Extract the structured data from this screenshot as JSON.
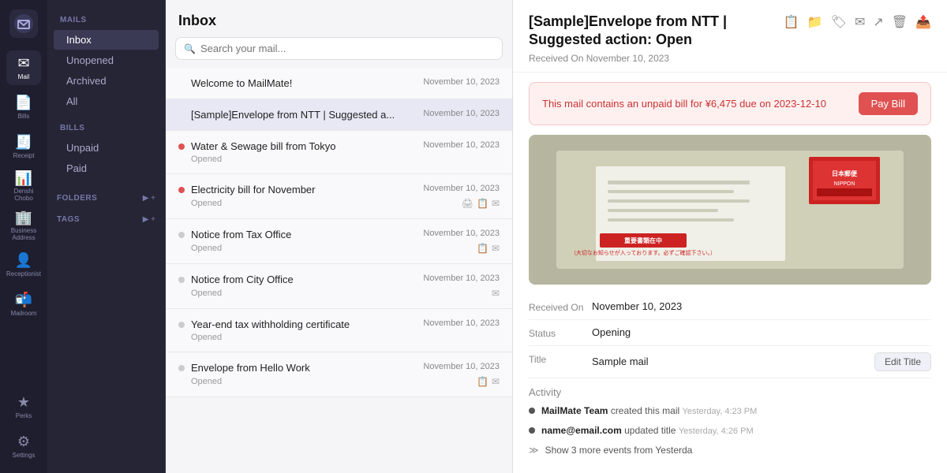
{
  "app": {
    "logo_icon": "●"
  },
  "sidebar": {
    "items": [
      {
        "id": "mail",
        "label": "Mail",
        "icon": "✉",
        "active": true
      },
      {
        "id": "bills",
        "label": "Bills",
        "icon": "📄",
        "active": false
      },
      {
        "id": "receipt",
        "label": "Receipt",
        "icon": "🧾",
        "active": false
      },
      {
        "id": "denshi",
        "label": "Denshi\nChobo",
        "icon": "📊",
        "active": false
      },
      {
        "id": "business",
        "label": "Business\nAddress",
        "icon": "🏢",
        "active": false
      },
      {
        "id": "receptionist",
        "label": "Receptionist",
        "icon": "👤",
        "active": false
      },
      {
        "id": "mailroom",
        "label": "Mailroom",
        "icon": "📬",
        "active": false
      }
    ],
    "bottom_items": [
      {
        "id": "perks",
        "label": "Perks",
        "icon": "★"
      },
      {
        "id": "settings",
        "label": "Settings",
        "icon": "⚙"
      }
    ]
  },
  "nav": {
    "mails_label": "MAILS",
    "mails_items": [
      {
        "id": "inbox",
        "label": "Inbox",
        "active": true
      },
      {
        "id": "unopened",
        "label": "Unopened",
        "active": false
      },
      {
        "id": "archived",
        "label": "Archived",
        "active": false
      },
      {
        "id": "all",
        "label": "All",
        "active": false
      }
    ],
    "bills_label": "BILLS",
    "bills_items": [
      {
        "id": "unpaid",
        "label": "Unpaid",
        "active": false
      },
      {
        "id": "paid",
        "label": "Paid",
        "active": false
      }
    ],
    "folders_label": "FOLDERS",
    "tags_label": "TAGS"
  },
  "mail_list": {
    "title": "Inbox",
    "search_placeholder": "Search your mail...",
    "items": [
      {
        "id": "welcome",
        "subject": "Welcome to MailMate!",
        "date": "November 10, 2023",
        "status": "",
        "dot": "none",
        "selected": false,
        "icons": []
      },
      {
        "id": "ntt",
        "subject": "[Sample]Envelope from NTT | Suggested a...",
        "date": "November 10, 2023",
        "status": "",
        "dot": "none",
        "selected": true,
        "icons": []
      },
      {
        "id": "water",
        "subject": "Water & Sewage bill from Tokyo",
        "date": "November 10, 2023",
        "status": "Opened",
        "dot": "red",
        "selected": false,
        "icons": []
      },
      {
        "id": "electricity",
        "subject": "Electricity bill for November",
        "date": "November 10, 2023",
        "status": "Opened",
        "dot": "red",
        "selected": false,
        "icons": [
          "🖨",
          "📋",
          "✉"
        ]
      },
      {
        "id": "tax",
        "subject": "Notice from Tax Office",
        "date": "November 10, 2023",
        "status": "Opened",
        "dot": "gray",
        "selected": false,
        "icons": [
          "📋",
          "✉"
        ]
      },
      {
        "id": "city",
        "subject": "Notice from City Office",
        "date": "November 10, 2023",
        "status": "Opened",
        "dot": "gray",
        "selected": false,
        "icons": [
          "✉"
        ]
      },
      {
        "id": "yearend",
        "subject": "Year-end tax withholding certificate",
        "date": "November 10, 2023",
        "status": "Opened",
        "dot": "gray",
        "selected": false,
        "icons": []
      },
      {
        "id": "hellowork",
        "subject": "Envelope from Hello Work",
        "date": "November 10, 2023",
        "status": "Opened",
        "dot": "gray",
        "selected": false,
        "icons": [
          "📋",
          "✉"
        ]
      }
    ]
  },
  "detail": {
    "title": "[Sample]Envelope from NTT | Suggested action: Open",
    "received_label": "Received On November 10, 2023",
    "toolbar_icons": [
      "📋",
      "📁",
      "🏷",
      "✉",
      "↗",
      "🗑",
      "📤"
    ],
    "bill_banner": {
      "text_before": "This mail contains an unpaid bill for",
      "amount": "¥6,475",
      "text_middle": "due on",
      "date": "2023-12-10",
      "pay_button": "Pay Bill"
    },
    "meta": {
      "received_on_label": "Received On",
      "received_on_value": "November 10, 2023",
      "status_label": "Status",
      "status_value": "Opening",
      "title_label": "Title",
      "title_value": "Sample mail",
      "edit_title_label": "Edit Title",
      "activity_label": "Activity",
      "activity_items": [
        {
          "id": "created",
          "actor": "MailMate Team",
          "action": "created this mail",
          "time": "Yesterday, 4:23 PM",
          "dot": "dark"
        },
        {
          "id": "updated",
          "actor": "name@email.com",
          "action": "updated title",
          "time": "Yesterday, 4:26 PM",
          "dot": "dark"
        }
      ],
      "show_more_text": "Show 3 more events from Yesterda"
    }
  }
}
